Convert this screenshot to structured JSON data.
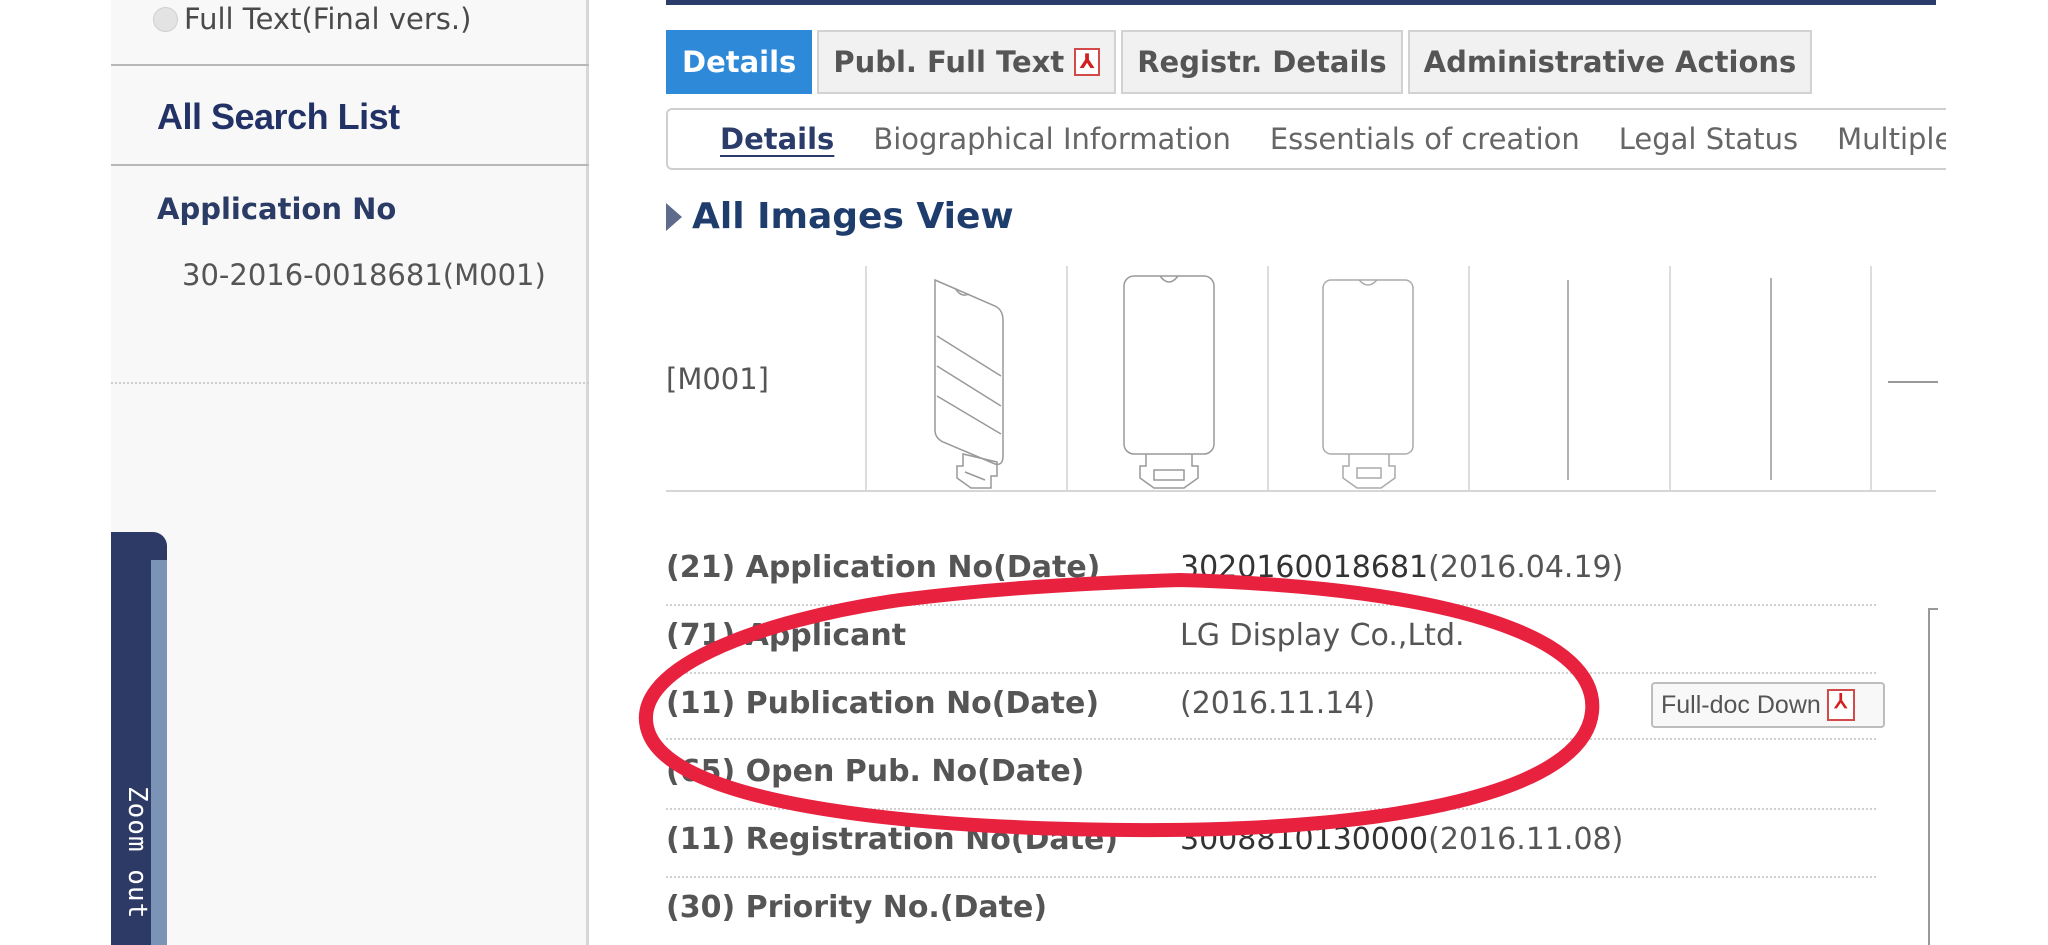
{
  "sidebar": {
    "full_text_option": "Full Text(Final vers.)",
    "search_list_title": "All Search List",
    "application_label": "Application No",
    "application_value": "30-2016-0018681(M001)",
    "zoom_label": "Zoom out"
  },
  "tabs": [
    {
      "label": "Details",
      "active": true
    },
    {
      "label": "Publ. Full Text",
      "icon": "pdf-icon"
    },
    {
      "label": "Registr. Details"
    },
    {
      "label": "Administrative Actions"
    }
  ],
  "subnav": [
    {
      "label": "Details",
      "active": true
    },
    {
      "label": "Biographical Information"
    },
    {
      "label": "Essentials of creation"
    },
    {
      "label": "Legal Status"
    },
    {
      "label": "Multiple D"
    }
  ],
  "images": {
    "heading": "All Images View",
    "label": "[M001]"
  },
  "details": [
    {
      "label": "(21) Application No(Date)",
      "number": "3020160018681",
      "date": "(2016.04.19)"
    },
    {
      "label": "(71) Applicant",
      "number": "LG Display Co.,Ltd.",
      "date": ""
    },
    {
      "label": "(11) Publication No(Date)",
      "number": "",
      "date": "(2016.11.14)"
    },
    {
      "label": "(65) Open Pub. No(Date)",
      "number": "",
      "date": ""
    },
    {
      "label": "(11) Registration No(Date)",
      "number": "3008810130000",
      "date": "(2016.11.08)"
    },
    {
      "label": "(30) Priority No.(Date)",
      "number": "",
      "date": ""
    }
  ],
  "fulldoc_button": "Full-doc Down",
  "colors": {
    "accent": "#2e8ad8",
    "navy": "#223266",
    "annotation": "#e8213f"
  }
}
